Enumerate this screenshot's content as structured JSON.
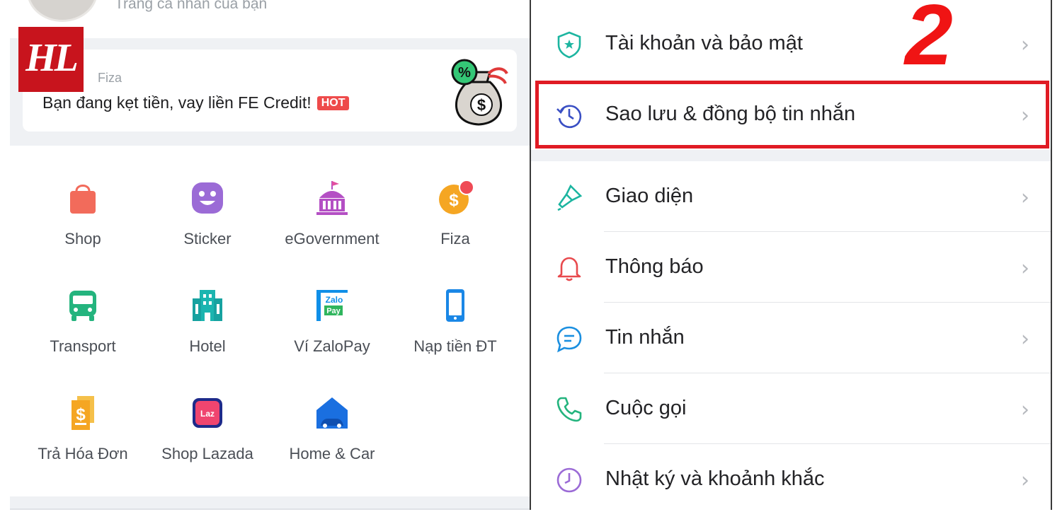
{
  "watermark": {
    "logo_text": "HL"
  },
  "step_badge": "2",
  "left": {
    "profile_subtitle": "Trang cá nhân của bạn",
    "ad": {
      "source": "Fiza",
      "title": "Bạn đang kẹt tiền, vay liền FE Credit!",
      "badge": "HOT"
    },
    "apps": [
      {
        "label": "Shop",
        "icon": "shopping-bag-icon",
        "color": "#f26b5b"
      },
      {
        "label": "Sticker",
        "icon": "smiley-sticker-icon",
        "color": "#9b6bd6"
      },
      {
        "label": "eGovernment",
        "icon": "government-building-icon",
        "color": "#b44fc4"
      },
      {
        "label": "Fiza",
        "icon": "fiza-coin-icon",
        "color": "#f5a623"
      },
      {
        "label": "Transport",
        "icon": "bus-icon",
        "color": "#24b47e"
      },
      {
        "label": "Hotel",
        "icon": "hotel-icon",
        "color": "#1bb5b0"
      },
      {
        "label": "Ví ZaloPay",
        "icon": "zalopay-icon",
        "color": "#0f8fe8"
      },
      {
        "label": "Nạp tiền ĐT",
        "icon": "phone-topup-icon",
        "color": "#1a87e6"
      },
      {
        "label": "Trả Hóa Đơn",
        "icon": "bill-payment-icon",
        "color": "#f5a623"
      },
      {
        "label": "Shop Lazada",
        "icon": "lazada-icon",
        "color": "#1e2a8a"
      },
      {
        "label": "Home & Car",
        "icon": "home-car-icon",
        "color": "#1a6fe0"
      }
    ]
  },
  "right": {
    "settings": [
      {
        "label": "Tài khoản và bảo mật",
        "icon": "shield-icon",
        "color": "#1cb5a0"
      },
      {
        "label": "Sao lưu & đồng bộ tin nhắn",
        "icon": "history-clock-icon",
        "color": "#3a4fc4"
      },
      {
        "label": "Giao diện",
        "icon": "paint-brush-icon",
        "color": "#1cb5a0"
      },
      {
        "label": "Thông báo",
        "icon": "bell-icon",
        "color": "#e8494d"
      },
      {
        "label": "Tin nhắn",
        "icon": "chat-bubble-icon",
        "color": "#1a8fe0"
      },
      {
        "label": "Cuộc gọi",
        "icon": "phone-call-icon",
        "color": "#24b47e"
      },
      {
        "label": "Nhật ký và khoảnh khắc",
        "icon": "clock-icon",
        "color": "#9b6bd6"
      }
    ],
    "chevron": "›"
  }
}
